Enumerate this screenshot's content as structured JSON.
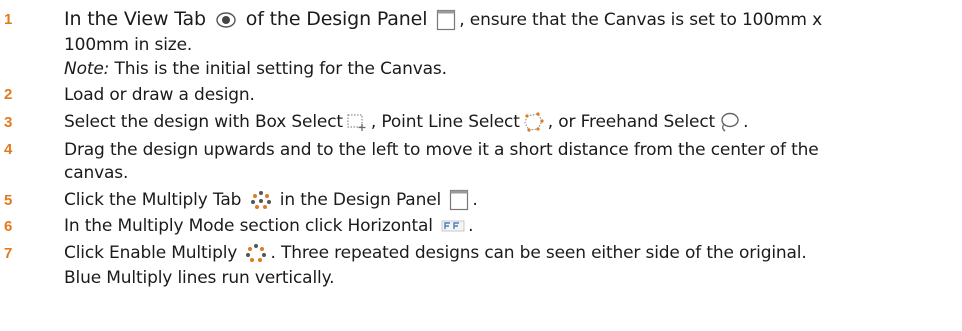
{
  "steps": [
    {
      "num": "1",
      "t1": "In the View Tab",
      "icon1": "eye-icon",
      "t2": "of the Design Panel",
      "icon2": "design-panel-icon",
      "t3": ", ensure that the Canvas is set to 100mm x",
      "t4": "100mm in size.",
      "note_label": "Note:",
      "note_text": " This is the initial setting for the Canvas."
    },
    {
      "num": "2",
      "text": "Load or draw a design."
    },
    {
      "num": "3",
      "t1": "Select the design with Box Select",
      "icon1": "box-select-icon",
      "t2": ", Point Line Select",
      "icon2": "point-line-select-icon",
      "t3": ", or Freehand Select",
      "icon3": "freehand-select-icon",
      "t4": "."
    },
    {
      "num": "4",
      "line1": "Drag the design upwards and to the left to move it a short distance from the center of the",
      "line2": "canvas."
    },
    {
      "num": "5",
      "t1": "Click the Multiply Tab",
      "icon1": "multiply-tab-icon",
      "t2": "in the Design Panel",
      "icon2": "design-panel-icon",
      "t3": "."
    },
    {
      "num": "6",
      "t1": "In the Multiply Mode section click Horizontal",
      "icon1": "horizontal-mode-icon",
      "t2": "."
    },
    {
      "num": "7",
      "t1": "Click Enable Multiply",
      "icon1": "enable-multiply-icon",
      "t2": ". Three repeated designs can be seen either side of the original.",
      "line2": "Blue Multiply lines run vertically."
    }
  ],
  "colors": {
    "number": "#e07a1f",
    "text": "#1b1b1b",
    "icon_gray": "#8a8a8a",
    "icon_orange": "#e07a1f"
  }
}
